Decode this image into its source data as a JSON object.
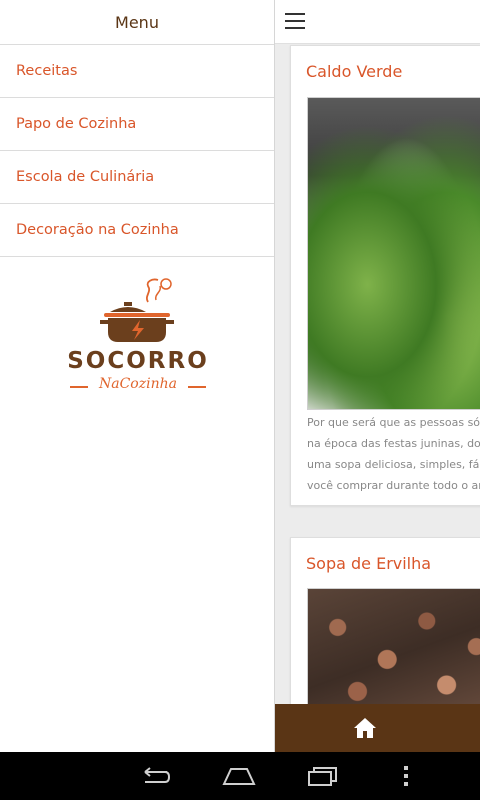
{
  "drawer": {
    "header": "Menu",
    "items": [
      {
        "label": "Receitas"
      },
      {
        "label": "Papo de Cozinha"
      },
      {
        "label": "Escola de Culinária"
      },
      {
        "label": "Decoração na Cozinha"
      }
    ],
    "logo": {
      "word": "SOCORRO",
      "sub": "NaCozinha"
    }
  },
  "feed": {
    "cards": [
      {
        "title": "Caldo Verde",
        "excerpt": [
          "Por que será que as pessoas só",
          "na época das festas juninas, do S",
          "uma sopa deliciosa, simples, fác",
          "você comprar durante todo o an"
        ]
      },
      {
        "title": "Sopa de Ervilha"
      }
    ]
  },
  "colors": {
    "accent": "#d9562a",
    "brown": "#5a3515",
    "drawer_bg": "#ffffff",
    "content_bg": "#ececec"
  },
  "icons": {
    "menu": "hamburger-icon",
    "home": "home-icon",
    "back": "back-icon",
    "nav_home": "nav-home-icon",
    "recents": "recents-icon",
    "overflow": "overflow-icon"
  }
}
